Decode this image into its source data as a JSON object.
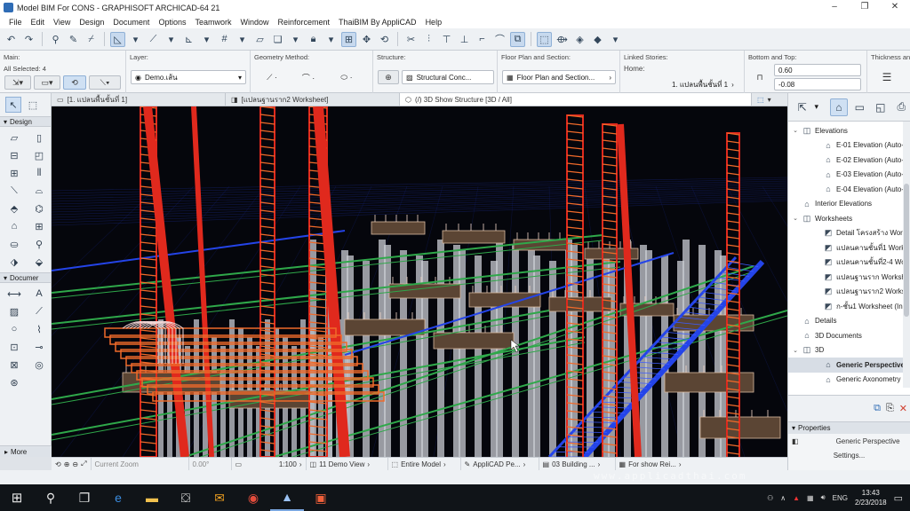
{
  "window": {
    "title": "Model BIM For CONS - GRAPHISOFT ARCHICAD-64 21",
    "controls": [
      "–",
      "❐",
      "✕"
    ]
  },
  "menu": [
    "File",
    "Edit",
    "View",
    "Design",
    "Document",
    "Options",
    "Teamwork",
    "Window",
    "Reinforcement",
    "ThaiBIM By AppliCAD",
    "Help"
  ],
  "infobox": {
    "main": {
      "title": "Main:",
      "selected": "All Selected: 4"
    },
    "layer": {
      "title": "Layer:",
      "value": "Demo.เส้น"
    },
    "geometry": {
      "title": "Geometry Method:"
    },
    "structure": {
      "title": "Structure:",
      "value": "Structural Conc..."
    },
    "floorplan": {
      "title": "Floor Plan and Section:",
      "value": "Floor Plan and Section..."
    },
    "linked": {
      "title": "Linked Stories:",
      "home": "Home:",
      "home_value": "1. แปลนพื้นชั้นที่ 1"
    },
    "bottomtop": {
      "title": "Bottom and Top:",
      "top": "0.60",
      "bottom": "-0.08"
    },
    "thickness": {
      "title": "Thickness and"
    }
  },
  "toolbox": {
    "design_label": "Design",
    "document_label": "Documer",
    "more_label": "More"
  },
  "tabs": [
    {
      "label": "[1. แปลนพื้นชั้นที่ 1]",
      "icon": "plan-icon"
    },
    {
      "label": "[แปลนฐานราก2 Worksheet]",
      "icon": "worksheet-icon"
    },
    {
      "label": "(/) 3D Show Structure [3D / All]",
      "icon": "3d-icon"
    }
  ],
  "statusbar": {
    "zoom": "Current Zoom",
    "angle": "0.00°",
    "scale": "1:100",
    "view": "11 Demo View",
    "model": "Entire Model",
    "pen": "AppliCAD Pe...",
    "building": "03 Building ...",
    "show": "For show Rei..."
  },
  "watermark": "www.applicadthai.com",
  "navigator": {
    "tree": [
      {
        "label": "Elevations",
        "level": 1,
        "arrow": "⌄",
        "icon": "elevation-folder-icon"
      },
      {
        "label": "E-01 Elevation (Auto-",
        "level": 2,
        "arrow": "",
        "icon": "elevation-icon"
      },
      {
        "label": "E-02 Elevation (Auto-",
        "level": 2,
        "arrow": "",
        "icon": "elevation-icon"
      },
      {
        "label": "E-03 Elevation (Auto-",
        "level": 2,
        "arrow": "",
        "icon": "elevation-icon"
      },
      {
        "label": "E-04 Elevation (Auto-",
        "level": 2,
        "arrow": "",
        "icon": "elevation-icon"
      },
      {
        "label": "Interior Elevations",
        "level": 1,
        "arrow": "",
        "icon": "interior-elevation-icon"
      },
      {
        "label": "Worksheets",
        "level": 1,
        "arrow": "⌄",
        "icon": "worksheet-folder-icon"
      },
      {
        "label": "Detail โครงสร้าง Work",
        "level": 2,
        "arrow": "",
        "icon": "worksheet-icon"
      },
      {
        "label": "แปลนคานชั้นที่1 Works",
        "level": 2,
        "arrow": "",
        "icon": "worksheet-icon"
      },
      {
        "label": "แปลนคานชั้นที่2-4 Worl",
        "level": 2,
        "arrow": "",
        "icon": "worksheet-icon"
      },
      {
        "label": "แปลนฐานราก Workshe",
        "level": 2,
        "arrow": "",
        "icon": "worksheet-icon"
      },
      {
        "label": "แปลนฐานราก2 Worksh",
        "level": 2,
        "arrow": "",
        "icon": "worksheet-icon"
      },
      {
        "label": "ก-ชั้น1 Worksheet (In",
        "level": 2,
        "arrow": "",
        "icon": "worksheet-icon"
      },
      {
        "label": "Details",
        "level": 1,
        "arrow": "",
        "icon": "details-icon"
      },
      {
        "label": "3D Documents",
        "level": 1,
        "arrow": "",
        "icon": "3d-documents-icon"
      },
      {
        "label": "3D",
        "level": 1,
        "arrow": "⌄",
        "icon": "3d-folder-icon"
      },
      {
        "label": "Generic Perspective",
        "level": 2,
        "arrow": "",
        "icon": "perspective-icon",
        "selected": true
      },
      {
        "label": "Generic Axonometry",
        "level": 2,
        "arrow": "",
        "icon": "axonometry-icon"
      }
    ]
  },
  "properties": {
    "title": "Properties",
    "value": "Generic Perspective",
    "settings": "Settings..."
  },
  "taskbar": {
    "lang": "ENG",
    "time": "13:43",
    "date": "2/23/2018"
  },
  "colors": {
    "rebar_red": "#e0291d",
    "rebar_orange": "#f06a2a",
    "beam_green": "#2fa84a",
    "beam_blue": "#2444e8",
    "pile_grey": "#c9ccd3",
    "slab_brown": "#5b4534",
    "background": "#05060c"
  }
}
